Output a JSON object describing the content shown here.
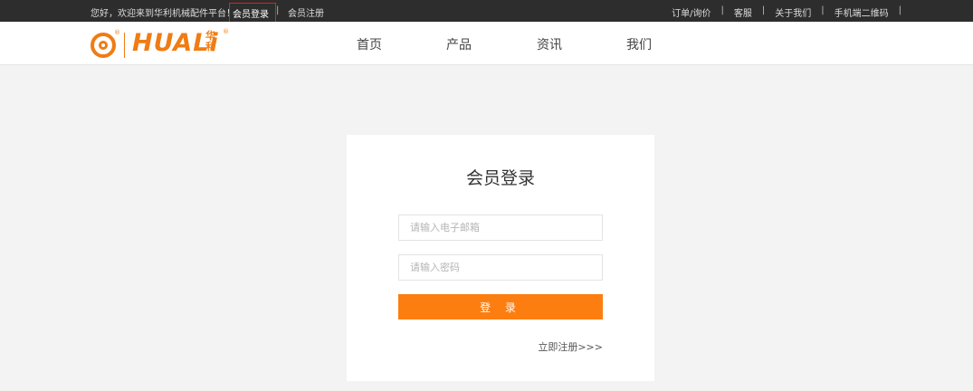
{
  "topbar": {
    "greeting": "您好，欢迎来到华利机械配件平台！",
    "login_label": "会员登录",
    "separator": "|",
    "register_label": "会员注册",
    "right_links": [
      "订单/询价",
      "客服",
      "关于我们",
      "手机端二维码"
    ]
  },
  "header": {
    "logo_text": "HUALi",
    "logo_cn": "华利",
    "logo_reg": "®",
    "nav": [
      "首页",
      "产品",
      "资讯",
      "我们"
    ]
  },
  "login_card": {
    "title": "会员登录",
    "email_placeholder": "请输入电子邮箱",
    "password_placeholder": "请输入密码",
    "submit_label": "登 录",
    "register_link": "立即注册>>>"
  },
  "colors": {
    "accent": "#fd7e10",
    "topbar_bg": "#2d2d2d",
    "page_bg": "#f3f3f3",
    "highlight_border": "#e02020"
  }
}
